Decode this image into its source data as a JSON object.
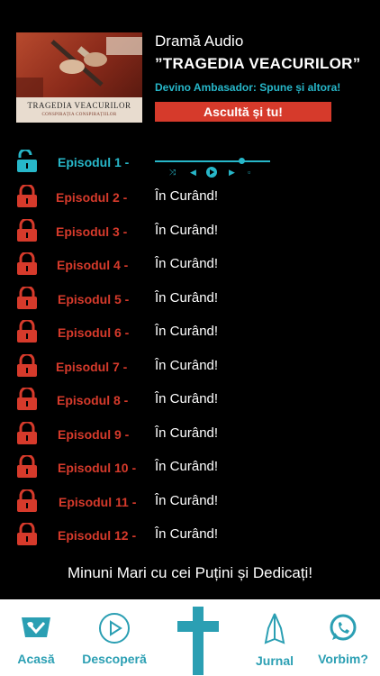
{
  "header": {
    "category": "Dramă Audio",
    "title": "”TRAGEDIA VEACURILOR”",
    "ambassador": "Devino Ambasador: Spune și altora!",
    "listen_button": "Ascultă și tu!",
    "cover": {
      "title": "TRAGEDIA VEACURILOR",
      "subtitle": "CONSPIRAȚIA CONSPIRAȚIILOR"
    }
  },
  "episodes": [
    {
      "label": "Episodul 1 -",
      "status": "",
      "unlocked": true
    },
    {
      "label": "Episodul 2 -",
      "status": "În Curând!",
      "unlocked": false
    },
    {
      "label": "Episodul 3 -",
      "status": "În Curând!",
      "unlocked": false
    },
    {
      "label": "Episodul 4 -",
      "status": "În Curând!",
      "unlocked": false
    },
    {
      "label": "Episodul 5 -",
      "status": "În Curând!",
      "unlocked": false
    },
    {
      "label": "Episodul 6 -",
      "status": "În Curând!",
      "unlocked": false
    },
    {
      "label": "Episodul 7 -",
      "status": "În Curând!",
      "unlocked": false
    },
    {
      "label": "Episodul 8 -",
      "status": "În Curând!",
      "unlocked": false
    },
    {
      "label": "Episodul 9 -",
      "status": "În Curând!",
      "unlocked": false
    },
    {
      "label": "Episodul 10 -",
      "status": "În Curând!",
      "unlocked": false
    },
    {
      "label": "Episodul 11 -",
      "status": "În Curând!",
      "unlocked": false
    },
    {
      "label": "Episodul 12 -",
      "status": "În Curând!",
      "unlocked": false
    }
  ],
  "player": {
    "progress": 0.75,
    "icons": [
      "shuffle-icon",
      "previous-icon",
      "play-icon",
      "next-icon",
      "repeat-icon"
    ]
  },
  "slogan": "Minuni Mari cu cei Puțini și Dedicați!",
  "tabs": [
    {
      "label": "Acasă",
      "icon": "home-logo-icon"
    },
    {
      "label": "Descoperă",
      "icon": "play-circle-icon"
    },
    {
      "label": "",
      "icon": "cross-icon"
    },
    {
      "label": "Jurnal",
      "icon": "praying-hands-icon"
    },
    {
      "label": "Vorbim?",
      "icon": "whatsapp-icon"
    }
  ],
  "colors": {
    "accent": "#27b7c9",
    "locked": "#d63a2b",
    "background": "#000000",
    "tab_text": "#2b9fb3"
  }
}
